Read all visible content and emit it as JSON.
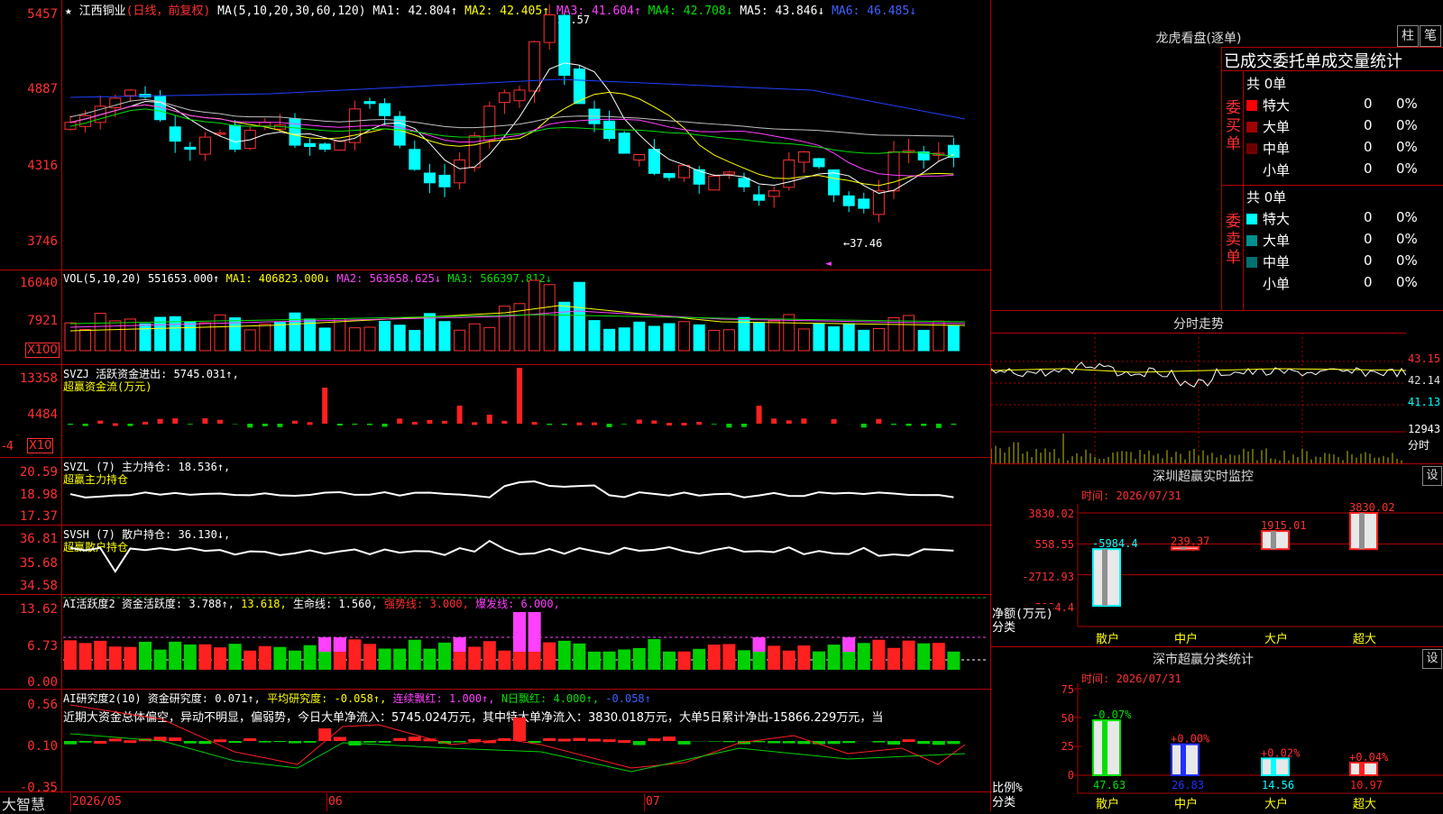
{
  "main_chart": {
    "title_marks": "★",
    "stock_name": "江西铜业",
    "period": "(日线，前复权)",
    "ma_header": "MA(5,10,20,30,60,120)",
    "ma1": "MA1: 42.804↑",
    "ma2": "MA2: 42.405↑",
    "ma3": "MA3: 41.604↑",
    "ma4": "MA4: 42.708↓",
    "ma5": "MA5: 43.846↓",
    "ma6": "MA6: 46.485↓",
    "ylabels": [
      "5457",
      "4887",
      "4316",
      "3746"
    ],
    "high_label": "54.57",
    "low_label": "←37.46",
    "marker": "◄"
  },
  "vol_panel": {
    "header": "VOL(5,10,20)",
    "value": "551653.000↑",
    "ma1": "MA1: 406823.000↓",
    "ma2": "MA2: 563658.625↓",
    "ma3": "MA3: 566397.812↓",
    "ylabels": [
      "16040",
      "7921"
    ],
    "unit": "X100"
  },
  "svzj_panel": {
    "header": "SVZJ  活跃资金进出: 5745.031↑,",
    "sub": "超赢资金流(万元)",
    "ylabels": [
      "13358",
      "4484",
      "-4"
    ],
    "unit": "X10"
  },
  "svzl_panel": {
    "header": "SVZL (7) 主力持仓: 18.536↑,",
    "sub": "超赢主力持仓",
    "ylabels": [
      "20.59",
      "18.98",
      "17.37"
    ]
  },
  "svsh_panel": {
    "header": "SVSH (7) 散户持仓: 36.130↓,",
    "sub": "超赢散户持仓",
    "ylabels": [
      "36.81",
      "35.68",
      "34.58"
    ]
  },
  "ai_active_panel": {
    "h1": "AI活跃度2 资金活跃度: 3.788↑,",
    "h2": "13.618,",
    "h3": "生命线: 1.560,",
    "h4": "强势线: 3.000,",
    "h5": "爆发线: 6.000,",
    "ylabels": [
      "13.62",
      "6.73",
      "0.00"
    ]
  },
  "ai_research_panel": {
    "h1": "AI研究度2(10) 资金研究度: 0.071↑,",
    "h2": "平均研究度: -0.058↑,",
    "h3": "连续飘红: 1.000↑,",
    "h4": "N日飘红: 4.000↑,",
    "h5": "-0.058↑",
    "ylabels": [
      "0.56",
      "0.10",
      "-0.35"
    ],
    "text": "近期大资金总体偏空，异动不明显，偏弱势，今日大单净流入：5745.024万元，其中特大单净流入：3830.018万元，大单5日累计净出-15866.229万元，当"
  },
  "bottom_axis": {
    "brand": "大智慧",
    "dates": [
      "2026/05",
      "06",
      "07"
    ]
  },
  "right_top": {
    "title": "龙虎看盘(逐单)",
    "tab1": "柱",
    "tab2": "笔",
    "header": "已成交委托单成交量统计",
    "buy_label": "委买单",
    "sell_label": "委卖单",
    "buy_total": "共 0单",
    "sell_total": "共 0单",
    "buy_rows": [
      {
        "name": "特大",
        "count": "0",
        "pct": "0%",
        "color": "#ff0000"
      },
      {
        "name": "大单",
        "count": "0",
        "pct": "0%",
        "color": "#a00000"
      },
      {
        "name": "中单",
        "count": "0",
        "pct": "0%",
        "color": "#700000"
      },
      {
        "name": "小单",
        "count": "0",
        "pct": "0%",
        "color": "#000000"
      }
    ],
    "sell_rows": [
      {
        "name": "特大",
        "count": "0",
        "pct": "0%",
        "color": "#00ffff"
      },
      {
        "name": "大单",
        "count": "0",
        "pct": "0%",
        "color": "#009090"
      },
      {
        "name": "中单",
        "count": "0",
        "pct": "0%",
        "color": "#007070"
      },
      {
        "name": "小单",
        "count": "0",
        "pct": "0%",
        "color": "#000000"
      }
    ]
  },
  "intraday": {
    "title": "分时走势",
    "ylabels": [
      "43.15",
      "42.14",
      "41.13"
    ],
    "vol_label": "12943",
    "unit": "分时"
  },
  "sz_monitor": {
    "title": "深圳超赢实时监控",
    "set": "设",
    "time": "时间: 2026/07/31",
    "ylabels": [
      "3830.02",
      "558.55",
      "-2712.93",
      "-5984.4"
    ],
    "ylabel_left": "净额(万元)",
    "xlabel_left": "分类",
    "categories": [
      "散户",
      "中户",
      "大户",
      "超大"
    ],
    "values": [
      -5984.4,
      239.37,
      1915.01,
      3830.02
    ],
    "value_labels": [
      "-5984.4",
      "239.37",
      "1915.01",
      "3830.02"
    ]
  },
  "sz_class": {
    "title": "深市超赢分类统计",
    "set": "设",
    "time": "时间: 2026/07/31",
    "ylabels": [
      "75",
      "50",
      "25",
      "0"
    ],
    "ylabel_left": "比例%",
    "xlabel_left": "分类",
    "categories": [
      "散户",
      "中户",
      "大户",
      "超大"
    ],
    "values": [
      47.63,
      26.83,
      14.56,
      10.97
    ],
    "changes": [
      "-0.07%",
      "+0.00%",
      "+0.02%",
      "+0.04%"
    ],
    "value_labels": [
      "47.63",
      "26.83",
      "14.56",
      "10.97"
    ]
  },
  "chart_data": [
    {
      "type": "bar",
      "title": "深圳超赢实时监控",
      "categories": [
        "散户",
        "中户",
        "大户",
        "超大"
      ],
      "values": [
        -5984.4,
        239.37,
        1915.01,
        3830.02
      ],
      "ylim": [
        -5984.4,
        3830.02
      ]
    },
    {
      "type": "bar",
      "title": "深市超赢分类统计",
      "categories": [
        "散户",
        "中户",
        "大户",
        "超大"
      ],
      "values": [
        47.63,
        26.83,
        14.56,
        10.97
      ],
      "ylim": [
        0,
        75
      ]
    }
  ]
}
